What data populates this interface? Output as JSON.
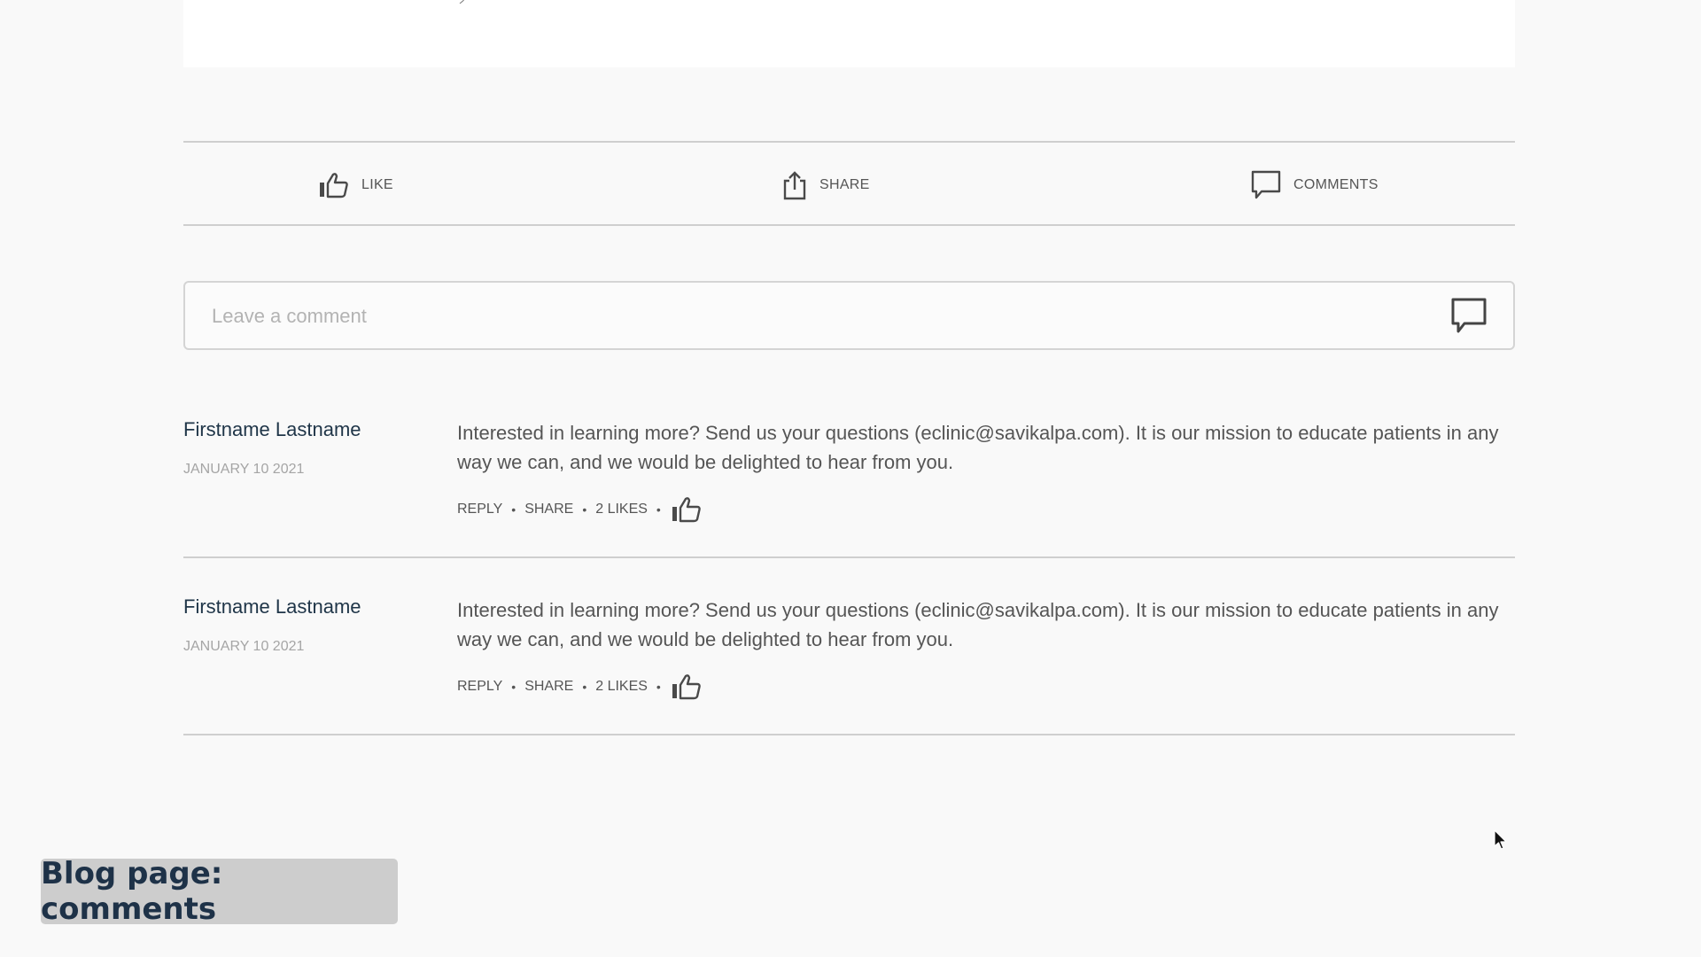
{
  "post_actions": {
    "like_label": "LIKE",
    "share_label": "SHARE",
    "comments_label": "COMMENTS"
  },
  "comment_form": {
    "placeholder": "Leave a comment"
  },
  "comments": [
    {
      "author": "Firstname Lastname",
      "date": "JANUARY 10 2021",
      "text": "Interested in learning more? Send us your questions (eclinic@savikalpa.com). It is our mission to educate patients in any way we can, and we would be delighted to hear from you.",
      "reply_label": "REPLY",
      "share_label": "SHARE",
      "likes_label": "2 LIKES"
    },
    {
      "author": "Firstname Lastname",
      "date": "JANUARY 10 2021",
      "text": "Interested in learning more? Send us your questions (eclinic@savikalpa.com). It is our mission to educate patients in any way we can, and we would be delighted to hear from you.",
      "reply_label": "REPLY",
      "share_label": "SHARE",
      "likes_label": "2 LIKES"
    }
  ],
  "caption": "Blog page: comments",
  "icons": {
    "like": "thumbs-up-icon",
    "share": "share-icon",
    "comments": "speech-bubble-icon",
    "cursor": "mouse-pointer-icon"
  },
  "colors": {
    "background": "#f9f9f9",
    "author": "#1f3548",
    "divider": "#cfcfcf",
    "caption_bg": "#cdcdcd",
    "caption_text": "#1e3248"
  }
}
